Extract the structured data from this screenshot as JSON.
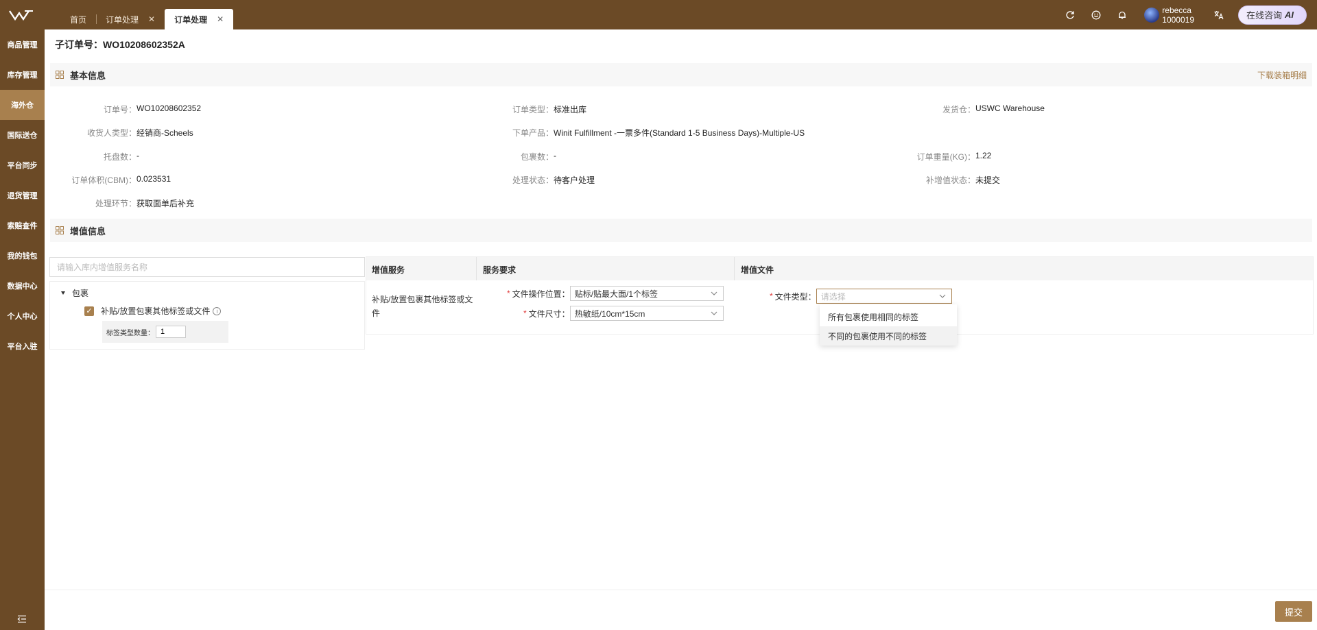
{
  "header": {
    "tabs": [
      {
        "label": "首页"
      },
      {
        "label": "订单处理",
        "closable": true
      },
      {
        "label": "订单处理",
        "closable": true,
        "active": true
      }
    ],
    "user": {
      "name": "rebecca",
      "id": "1000019"
    },
    "ai_button": {
      "label": "在线咨询",
      "badge": "AI"
    },
    "icons": [
      "refresh-icon",
      "smile-icon",
      "bell-icon",
      "translate-icon"
    ]
  },
  "sidebar": {
    "items": [
      {
        "label": "商品管理"
      },
      {
        "label": "库存管理"
      },
      {
        "label": "海外仓",
        "active": true
      },
      {
        "label": "国际送仓"
      },
      {
        "label": "平台同步"
      },
      {
        "label": "退货管理"
      },
      {
        "label": "索赔查件"
      },
      {
        "label": "我的钱包"
      },
      {
        "label": "数据中心"
      },
      {
        "label": "个人中心"
      },
      {
        "label": "平台入驻"
      }
    ]
  },
  "page": {
    "order_title": "子订单号：WO10208602352A",
    "basic_section": {
      "title": "基本信息",
      "download_link": "下载装箱明细"
    },
    "basic_info": [
      [
        {
          "label": "订单号：",
          "value": "WO10208602352"
        },
        {
          "label": "订单类型：",
          "value": "标准出库"
        },
        {
          "label": "发货仓：",
          "value": "USWC Warehouse"
        }
      ],
      [
        {
          "label": "收货人类型：",
          "value": "经销商-Scheels"
        },
        {
          "label": "下单产品：",
          "value": "Winit Fulfillment -一票多件(Standard 1-5 Business Days)-Multiple-US"
        },
        null
      ],
      [
        {
          "label": "托盘数：",
          "value": "-"
        },
        {
          "label": "包裹数：",
          "value": "-"
        },
        {
          "label": "订单重量(KG)：",
          "value": "1.22"
        }
      ],
      [
        {
          "label": "订单体积(CBM)：",
          "value": "0.023531"
        },
        {
          "label": "处理状态：",
          "value": "待客户处理"
        },
        {
          "label": "补增值状态：",
          "value": "未提交"
        }
      ],
      [
        {
          "label": "处理环节：",
          "value": "获取面单后补充"
        },
        null,
        null
      ]
    ],
    "vas_section": {
      "title": "增值信息"
    },
    "search": {
      "placeholder": "请输入库内增值服务名称",
      "value": ""
    },
    "tree": {
      "node": "包裹",
      "item": {
        "label": "补贴/放置包裹其他标签或文件",
        "checked": true
      },
      "qty_label": "标签类型数量：",
      "qty_value": "1"
    },
    "table": {
      "headers": [
        "增值服务",
        "服务要求",
        "增值文件"
      ],
      "service_name": "补贴/放置包裹其他标签或文件",
      "op_position": {
        "label": "文件操作位置：",
        "value": "贴标/贴最大面/1个标签"
      },
      "file_size": {
        "label": "文件尺寸：",
        "value": "热敏纸/10cm*15cm"
      },
      "file_type": {
        "label": "文件类型：",
        "placeholder": "请选择"
      }
    },
    "dropdown_options": [
      "所有包裹使用相同的标签",
      "不同的包裹使用不同的标签"
    ],
    "submit_label": "提交"
  },
  "colors": {
    "brand": "#6b4a26",
    "accent": "#a8804e",
    "required": "#e03c3c"
  }
}
